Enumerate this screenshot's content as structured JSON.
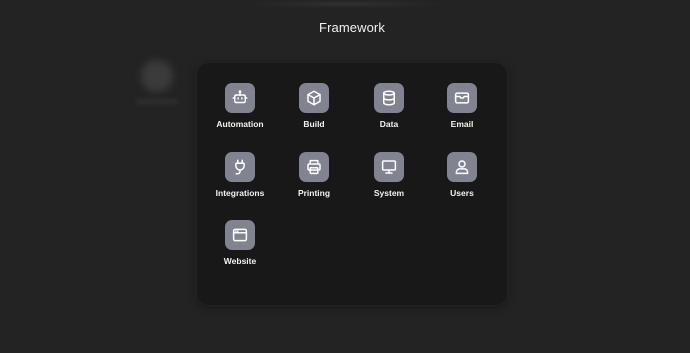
{
  "header": {
    "title": "Framework"
  },
  "apps": [
    {
      "label": "Automation",
      "icon": "robot-icon"
    },
    {
      "label": "Build",
      "icon": "cube-icon"
    },
    {
      "label": "Data",
      "icon": "database-icon"
    },
    {
      "label": "Email",
      "icon": "envelope-icon"
    },
    {
      "label": "Integrations",
      "icon": "plug-icon"
    },
    {
      "label": "Printing",
      "icon": "printer-icon"
    },
    {
      "label": "System",
      "icon": "monitor-icon"
    },
    {
      "label": "Users",
      "icon": "user-icon"
    },
    {
      "label": "Website",
      "icon": "browser-window-icon"
    }
  ],
  "colors": {
    "background": "#232323",
    "panel": "#181818",
    "tile": "#818490",
    "text": "#f3f3f3",
    "icon_stroke": "#ffffff"
  }
}
